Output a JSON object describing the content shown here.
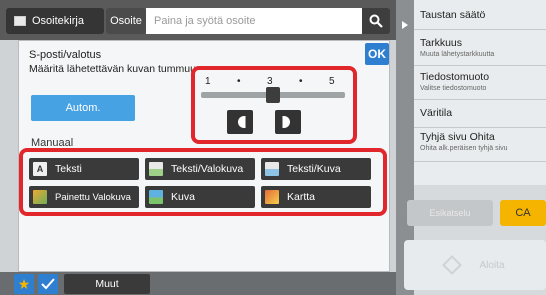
{
  "header": {
    "tab_addressbook": "Osoitekirja",
    "tab_address": "Osoite",
    "address_placeholder": "Paina ja syötä osoite"
  },
  "dialog": {
    "title": "S-posti/valotus",
    "subtitle": "Määritä lähetettävän kuvan tummuus",
    "ok_label": "OK",
    "auto_label": "Autom.",
    "manual_label": "Manuaal",
    "slider": {
      "ticks": [
        "1",
        "•",
        "3",
        "•",
        "5"
      ],
      "value": 3,
      "min": 1,
      "max": 5
    },
    "image_types": [
      {
        "label": "Teksti",
        "icon": "text-doc-icon",
        "color": "#f0f0f0"
      },
      {
        "label": "Teksti/Valokuva",
        "icon": "text-photo-icon",
        "color": "#9fd08a"
      },
      {
        "label": "Teksti/Kuva",
        "icon": "text-image-icon",
        "color": "#8ec4e6"
      },
      {
        "label": "Painettu Valokuva",
        "icon": "printed-photo-icon",
        "color": "#f0a830"
      },
      {
        "label": "Kuva",
        "icon": "image-icon",
        "color": "#5fb1e0"
      },
      {
        "label": "Kartta",
        "icon": "map-icon",
        "color": "#e36b3a"
      }
    ]
  },
  "side_panel": {
    "items": [
      {
        "label": "Taustan säätö",
        "sub": ""
      },
      {
        "label": "Tarkkuus",
        "sub": "Muuta lähetystarkkuutta"
      },
      {
        "label": "Tiedostomuoto",
        "sub": "Valitse tiedostomuoto"
      },
      {
        "label": "Väritila",
        "sub": ""
      },
      {
        "label": "Tyhjä sivu Ohita",
        "sub": "Ohita alk.peräisen tyhjä sivu"
      }
    ],
    "preview_label": "Esikatselu",
    "ca_label": "CA",
    "start_label": "Aloita"
  },
  "bottom": {
    "more_label": "Muut"
  },
  "colors": {
    "highlight": "#e1262c",
    "accent": "#2f7fd0",
    "ca": "#f4b400"
  }
}
